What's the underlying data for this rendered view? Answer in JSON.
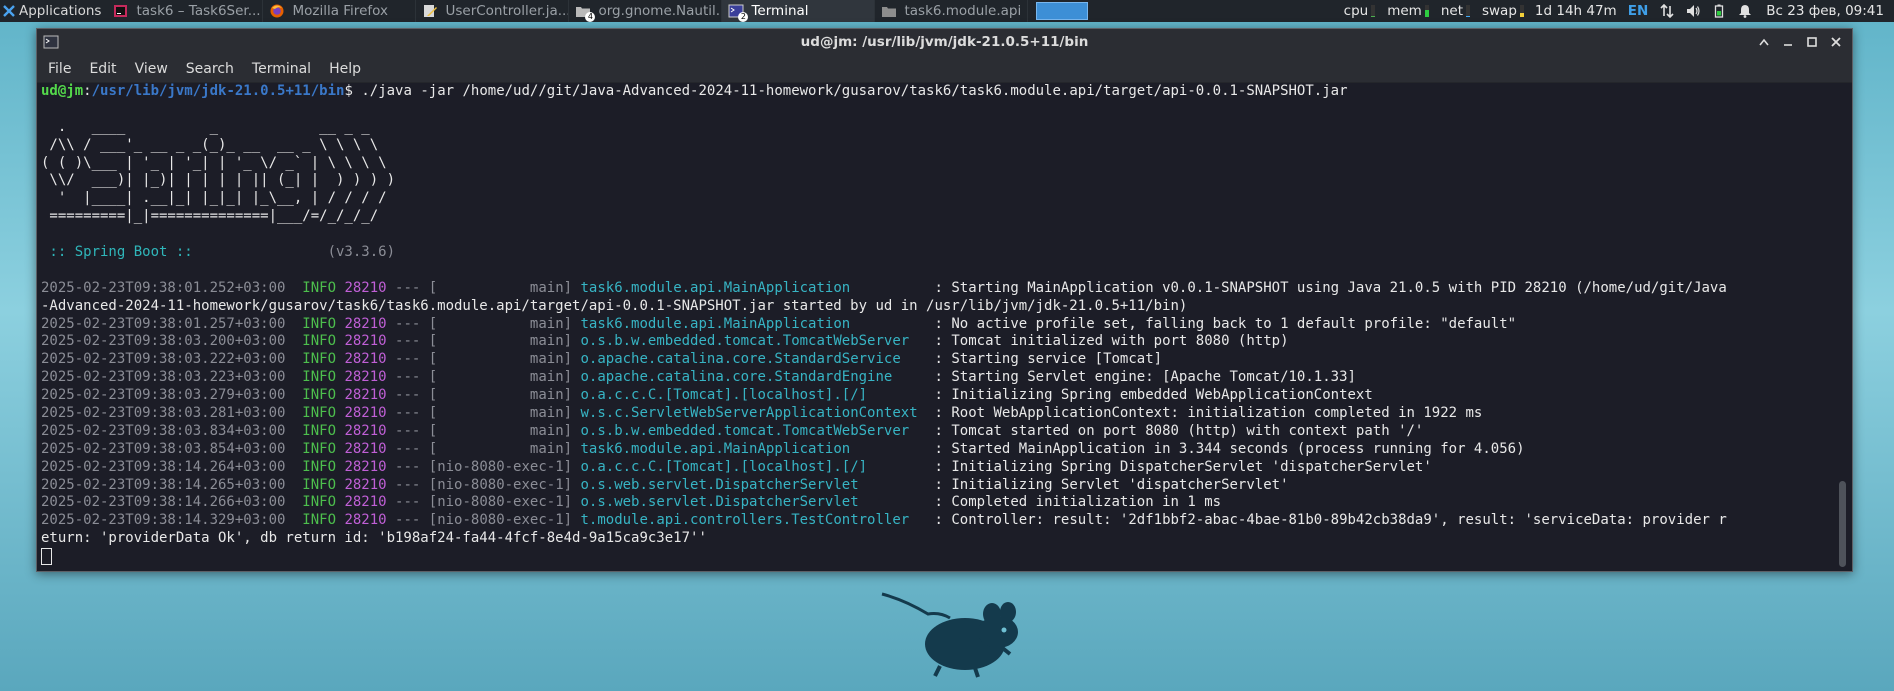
{
  "panel": {
    "applications_label": "Applications",
    "tasks": [
      {
        "label": "task6 – Task6Ser...",
        "icon": "intellij-icon",
        "active": false
      },
      {
        "label": "Mozilla Firefox",
        "icon": "firefox-icon",
        "active": false
      },
      {
        "label": "UserController.ja...",
        "icon": "text-editor-icon",
        "active": false
      },
      {
        "label": "org.gnome.Nautil...",
        "icon": "file-manager-icon",
        "active": false,
        "badge": "4"
      },
      {
        "label": "Terminal",
        "icon": "terminal-icon",
        "active": true,
        "badge": "2"
      },
      {
        "label": "task6.module.api",
        "icon": "folder-icon",
        "active": false
      }
    ],
    "monitors": {
      "cpu_label": "cpu",
      "mem_label": "mem",
      "net_label": "net",
      "swap_label": "swap",
      "cpu_level": 0.1,
      "mem_level": 0.55,
      "net_level": 0.05,
      "swap_level": 0.3
    },
    "uptime": "1d 14h 47m",
    "language": "EN",
    "clock": "Вс 23 фев, 09:41"
  },
  "window": {
    "title": "ud@jm: /usr/lib/jvm/jdk-21.0.5+11/bin",
    "menu": [
      "File",
      "Edit",
      "View",
      "Search",
      "Terminal",
      "Help"
    ]
  },
  "terminal": {
    "prompt_user": "ud@jm",
    "prompt_sep": ":",
    "prompt_path": "/usr/lib/jvm/jdk-21.0.5+11/bin",
    "prompt_end": "$",
    "command": " ./java -jar /home/ud//git/Java-Advanced-2024-11-homework/gusarov/task6/task6.module.api/target/api-0.0.1-SNAPSHOT.jar",
    "banner": [
      "",
      "  .   ____          _            __ _ _",
      " /\\\\ / ___'_ __ _ _(_)_ __  __ _ \\ \\ \\ \\",
      "( ( )\\___ | '_ | '_| | '_ \\/ _` | \\ \\ \\ \\",
      " \\\\/  ___)| |_)| | | | | || (_| |  ) ) ) )",
      "  '  |____| .__|_| |_|_| |_\\__, | / / / /",
      " =========|_|==============|___/=/_/_/_/",
      ""
    ],
    "spring_label": " :: Spring Boot ::",
    "spring_version": "                (v3.3.6)",
    "logs": [
      {
        "ts": "2025-02-23T09:38:01.252+03:00",
        "level": "INFO",
        "pid": "28210",
        "sep": " --- [",
        "thread": "           main] ",
        "logger": "task6.module.api.MainApplication         ",
        "msg": " : Starting MainApplication v0.0.1-SNAPSHOT using Java 21.0.5 with PID 28210 (/home/ud/git/Java",
        "cont": "-Advanced-2024-11-homework/gusarov/task6/task6.module.api/target/api-0.0.1-SNAPSHOT.jar started by ud in /usr/lib/jvm/jdk-21.0.5+11/bin)"
      },
      {
        "ts": "2025-02-23T09:38:01.257+03:00",
        "level": "INFO",
        "pid": "28210",
        "sep": " --- [",
        "thread": "           main] ",
        "logger": "task6.module.api.MainApplication         ",
        "msg": " : No active profile set, falling back to 1 default profile: \"default\""
      },
      {
        "ts": "2025-02-23T09:38:03.200+03:00",
        "level": "INFO",
        "pid": "28210",
        "sep": " --- [",
        "thread": "           main] ",
        "logger": "o.s.b.w.embedded.tomcat.TomcatWebServer  ",
        "msg": " : Tomcat initialized with port 8080 (http)"
      },
      {
        "ts": "2025-02-23T09:38:03.222+03:00",
        "level": "INFO",
        "pid": "28210",
        "sep": " --- [",
        "thread": "           main] ",
        "logger": "o.apache.catalina.core.StandardService   ",
        "msg": " : Starting service [Tomcat]"
      },
      {
        "ts": "2025-02-23T09:38:03.223+03:00",
        "level": "INFO",
        "pid": "28210",
        "sep": " --- [",
        "thread": "           main] ",
        "logger": "o.apache.catalina.core.StandardEngine    ",
        "msg": " : Starting Servlet engine: [Apache Tomcat/10.1.33]"
      },
      {
        "ts": "2025-02-23T09:38:03.279+03:00",
        "level": "INFO",
        "pid": "28210",
        "sep": " --- [",
        "thread": "           main] ",
        "logger": "o.a.c.c.C.[Tomcat].[localhost].[/]       ",
        "msg": " : Initializing Spring embedded WebApplicationContext"
      },
      {
        "ts": "2025-02-23T09:38:03.281+03:00",
        "level": "INFO",
        "pid": "28210",
        "sep": " --- [",
        "thread": "           main] ",
        "logger": "w.s.c.ServletWebServerApplicationContext ",
        "msg": " : Root WebApplicationContext: initialization completed in 1922 ms"
      },
      {
        "ts": "2025-02-23T09:38:03.834+03:00",
        "level": "INFO",
        "pid": "28210",
        "sep": " --- [",
        "thread": "           main] ",
        "logger": "o.s.b.w.embedded.tomcat.TomcatWebServer  ",
        "msg": " : Tomcat started on port 8080 (http) with context path '/'"
      },
      {
        "ts": "2025-02-23T09:38:03.854+03:00",
        "level": "INFO",
        "pid": "28210",
        "sep": " --- [",
        "thread": "           main] ",
        "logger": "task6.module.api.MainApplication         ",
        "msg": " : Started MainApplication in 3.344 seconds (process running for 4.056)"
      },
      {
        "ts": "2025-02-23T09:38:14.264+03:00",
        "level": "INFO",
        "pid": "28210",
        "sep": " --- [",
        "thread": "nio-8080-exec-1] ",
        "logger": "o.a.c.c.C.[Tomcat].[localhost].[/]       ",
        "msg": " : Initializing Spring DispatcherServlet 'dispatcherServlet'"
      },
      {
        "ts": "2025-02-23T09:38:14.265+03:00",
        "level": "INFO",
        "pid": "28210",
        "sep": " --- [",
        "thread": "nio-8080-exec-1] ",
        "logger": "o.s.web.servlet.DispatcherServlet        ",
        "msg": " : Initializing Servlet 'dispatcherServlet'"
      },
      {
        "ts": "2025-02-23T09:38:14.266+03:00",
        "level": "INFO",
        "pid": "28210",
        "sep": " --- [",
        "thread": "nio-8080-exec-1] ",
        "logger": "o.s.web.servlet.DispatcherServlet        ",
        "msg": " : Completed initialization in 1 ms"
      },
      {
        "ts": "2025-02-23T09:38:14.329+03:00",
        "level": "INFO",
        "pid": "28210",
        "sep": " --- [",
        "thread": "nio-8080-exec-1] ",
        "logger": "t.module.api.controllers.TestController  ",
        "msg": " : Controller: result: '2df1bbf2-abac-4bae-81b0-89b42cb38da9', result: 'serviceData: provider r",
        "cont": "eturn: 'providerData Ok', db return id: 'b198af24-fa44-4fcf-8e4d-9a15ca9c3e17''"
      }
    ]
  },
  "colors": {
    "panel_bg": "#20252b",
    "terminal_bg": "#1c1d27",
    "prompt_user": "#54d94b",
    "prompt_path": "#3a78c9",
    "info": "#4dbf4d",
    "pid": "#c05fd6",
    "logger": "#37b4c4",
    "desktop": "#6fc0d3"
  }
}
